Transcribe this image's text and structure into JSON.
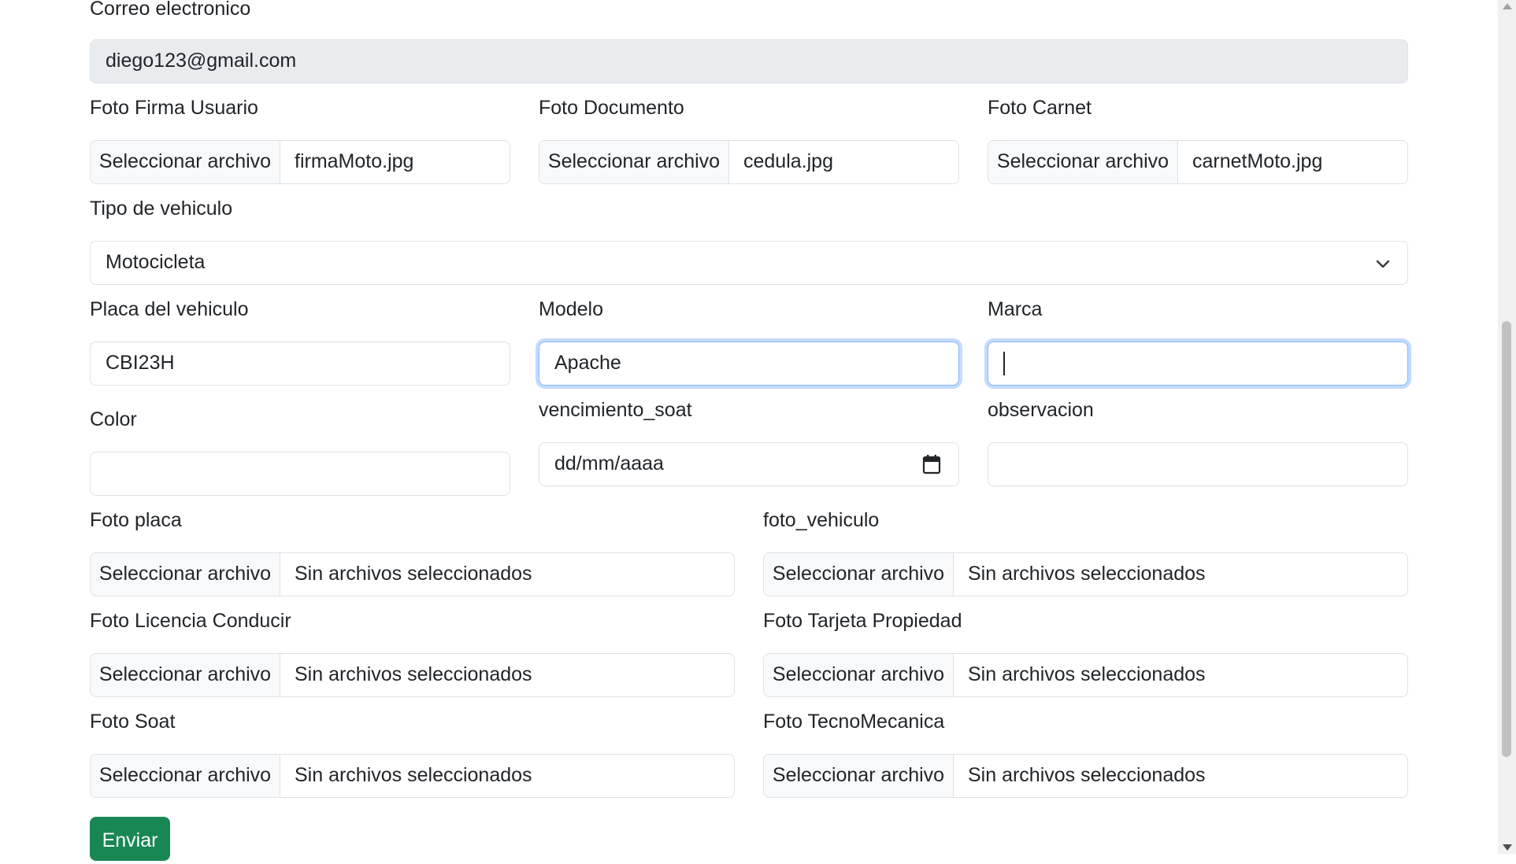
{
  "form": {
    "email": {
      "label": "Correo electronico",
      "value": "diego123@gmail.com"
    },
    "select_file_label": "Seleccionar archivo",
    "foto_firma": {
      "label": "Foto Firma Usuario",
      "file": "firmaMoto.jpg"
    },
    "foto_documento": {
      "label": "Foto Documento",
      "file": "cedula.jpg"
    },
    "foto_carnet": {
      "label": "Foto Carnet",
      "file": "carnetMoto.jpg"
    },
    "tipo_vehiculo": {
      "label": "Tipo de vehiculo",
      "selected": "Motocicleta"
    },
    "placa": {
      "label": "Placa del vehiculo",
      "value": "CBI23H"
    },
    "modelo": {
      "label": "Modelo",
      "value": "Apache"
    },
    "marca": {
      "label": "Marca",
      "value": ""
    },
    "color": {
      "label": "Color",
      "value": ""
    },
    "vencimiento_soat": {
      "label": "vencimiento_soat",
      "placeholder": "dd/mm/aaaa"
    },
    "observacion": {
      "label": "observacion",
      "value": ""
    },
    "no_file_text": "Sin archivos seleccionados",
    "foto_placa": {
      "label": "Foto placa"
    },
    "foto_vehiculo": {
      "label": "foto_vehiculo"
    },
    "foto_licencia": {
      "label": "Foto Licencia Conducir"
    },
    "foto_tarjeta": {
      "label": "Foto Tarjeta Propiedad"
    },
    "foto_soat": {
      "label": "Foto Soat"
    },
    "foto_tecno": {
      "label": "Foto TecnoMecanica"
    },
    "submit_label": "Enviar"
  },
  "colors": {
    "submit": "#198754",
    "focus_border": "#86b7fe",
    "disabled_bg": "#e9ecef"
  },
  "icons": {
    "select": "chevron-down-icon",
    "date": "calendar-icon"
  }
}
